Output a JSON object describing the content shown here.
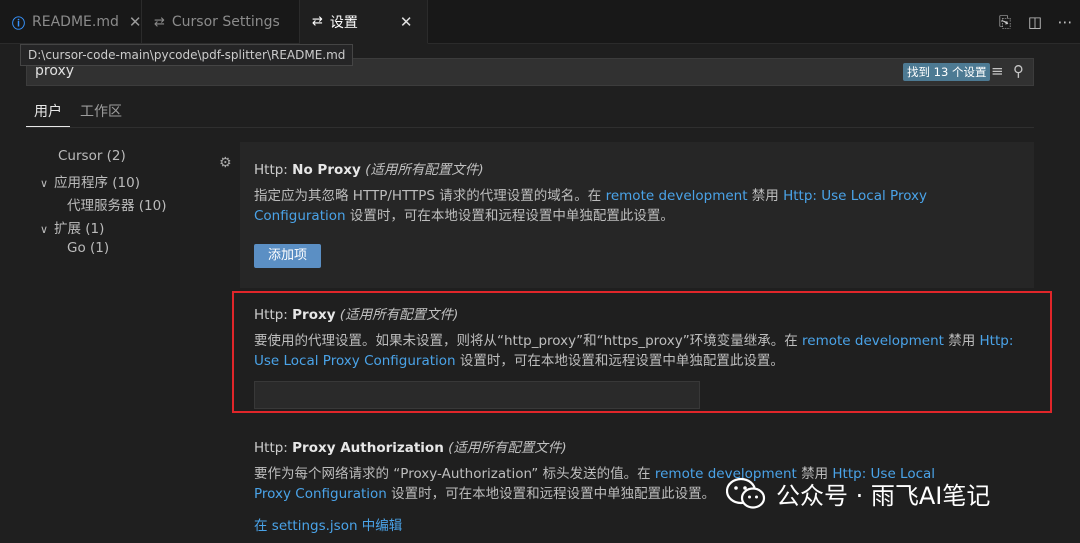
{
  "tabs": [
    {
      "label": "README.md",
      "icon": "info-icon"
    },
    {
      "label": "Cursor Settings",
      "icon": "settings-sliders-icon"
    },
    {
      "label": "设置",
      "icon": "settings-sliders-icon"
    }
  ],
  "tooltip": "D:\\cursor-code-main\\pycode\\pdf-splitter\\README.md",
  "search": {
    "value": "proxy",
    "found": "找到 13 个设置"
  },
  "scope_tabs": [
    "用户",
    "工作区"
  ],
  "toc": [
    {
      "label": "Cursor (2)"
    },
    {
      "label": "应用程序 (10)"
    },
    {
      "label": "代理服务器 (10)"
    },
    {
      "label": "扩展 (1)"
    },
    {
      "label": "Go (1)"
    }
  ],
  "settings": [
    {
      "category": "Http: ",
      "name": "No Proxy",
      "scope": "(适用所有配置文件)",
      "desc_parts": [
        "指定应为其忽略 HTTP/HTTPS 请求的代理设置的域名。在 ",
        "remote development",
        " 禁用 ",
        "Http: Use Local Proxy Configuration",
        " 设置时，可在本地设置和远程设置中单独配置此设置。"
      ],
      "button": "添加项"
    },
    {
      "category": "Http: ",
      "name": "Proxy",
      "scope": "(适用所有配置文件)",
      "desc_parts": [
        "要使用的代理设置。如果未设置，则将从“http_proxy”和“https_proxy”环境变量继承。在 ",
        "remote development",
        " 禁用 ",
        "Http: Use Local Proxy Configuration",
        " 设置时，可在本地设置和远程设置中单独配置此设置。"
      ]
    },
    {
      "category": "Http: ",
      "name": "Proxy Authorization",
      "scope": "(适用所有配置文件)",
      "desc_parts": [
        "要作为每个网络请求的 “Proxy-Authorization” 标头发送的值。在 ",
        "remote development",
        " 禁用 ",
        "Http: Use Local Proxy Configuration",
        " 设置时，可在本地设置和远程设置中单独配置此设置。"
      ],
      "edit_link": "在 settings.json 中编辑"
    }
  ],
  "watermark": "公众号 · 雨飞AI笔记",
  "colors": {
    "accent": "#4aa3e8",
    "highlight_border": "#e0262a",
    "button": "#5b8fc4"
  }
}
